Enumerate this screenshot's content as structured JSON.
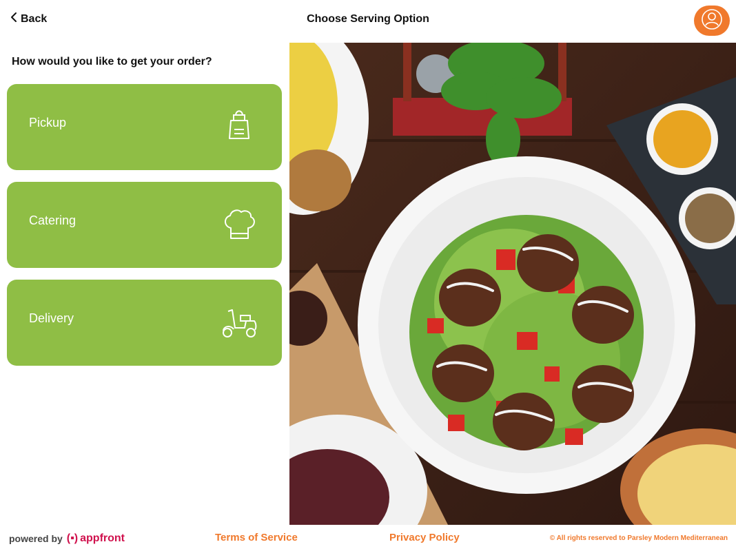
{
  "header": {
    "back_label": "Back",
    "title": "Choose Serving Option",
    "back_icon": "chevron-left-icon",
    "profile_icon": "user-icon",
    "accent_color": "#f0792c"
  },
  "main": {
    "question": "How would you like to get your order?",
    "option_color": "#8fbe45",
    "options": [
      {
        "label": "Pickup",
        "icon": "shopping-bag-icon"
      },
      {
        "label": "Catering",
        "icon": "chef-hat-icon"
      },
      {
        "label": "Delivery",
        "icon": "scooter-icon"
      }
    ]
  },
  "hero": {
    "image_subject": "food-photo"
  },
  "footer": {
    "powered_by": "powered by",
    "brand_mark": "(▪)",
    "brand_name": "appfront",
    "brand_color": "#d0114d",
    "terms_label": "Terms of Service",
    "privacy_label": "Privacy Policy",
    "rights_text": "© All rights reserved to Parsley Modern Mediterranean"
  }
}
